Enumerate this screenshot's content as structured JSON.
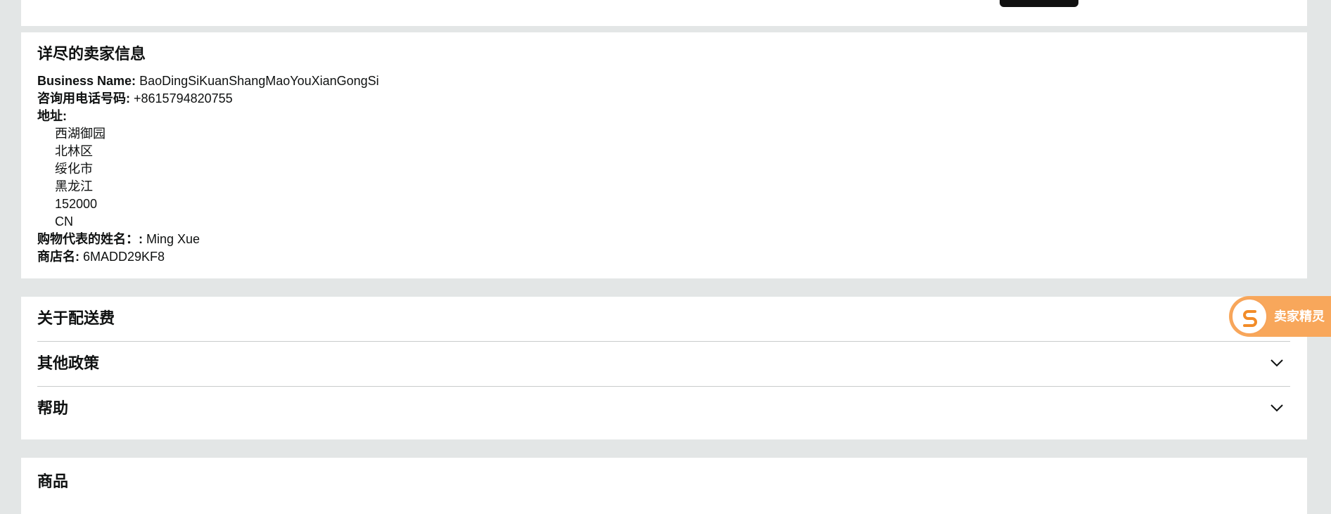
{
  "seller_info": {
    "title": "详尽的卖家信息",
    "business_name_label": "Business Name:",
    "business_name_value": "BaoDingSiKuanShangMaoYouXianGongSi",
    "phone_label": "咨询用电话号码:",
    "phone_value": "+8615794820755",
    "address_label": "地址:",
    "address_lines": [
      "西湖御园",
      "北林区",
      "绥化市",
      "黑龙江",
      "152000",
      "CN"
    ],
    "rep_label": "购物代表的姓名：:",
    "rep_value": "Ming Xue",
    "store_label": "商店名:",
    "store_value": "6MADD29KF8"
  },
  "sections": [
    {
      "label": "关于配送费",
      "icon": "none"
    },
    {
      "label": "其他政策",
      "icon": "chevron-down-icon"
    },
    {
      "label": "帮助",
      "icon": "chevron-down-icon"
    }
  ],
  "products": {
    "title": "商品"
  },
  "floating_widget": {
    "label": "卖家精灵",
    "accent": "#f8a75b",
    "icon": "s-logo-icon"
  }
}
